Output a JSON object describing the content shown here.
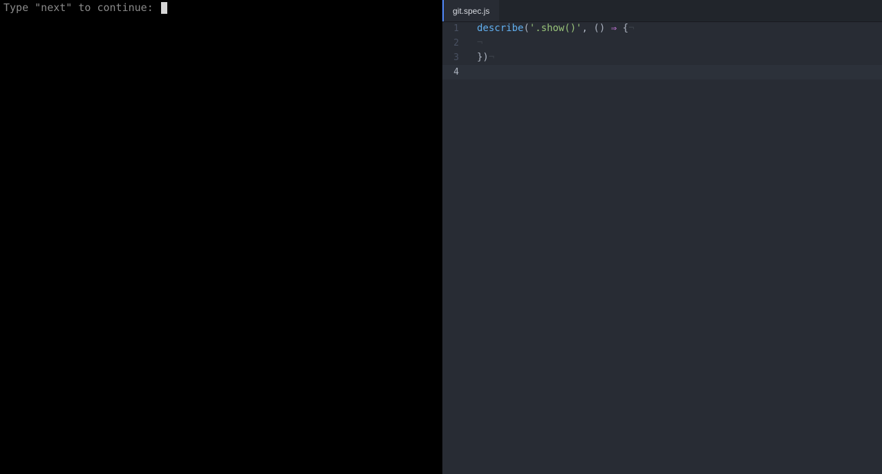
{
  "terminal": {
    "prompt": "Type \"next\" to continue: "
  },
  "editor": {
    "tab_title": "git.spec.js",
    "line_numbers": [
      "1",
      "2",
      "3",
      "4"
    ],
    "code": {
      "line1": {
        "fn": "describe",
        "open_paren": "(",
        "string": "'.show()'",
        "comma_parens": ", () ",
        "arrow": "⇒",
        "brace": " {",
        "eol": "¬"
      },
      "line2": {
        "eol": "¬"
      },
      "line3": {
        "text": "})",
        "eol": "¬"
      }
    }
  },
  "colors": {
    "editor_bg": "#282c34",
    "function": "#61afef",
    "string": "#98c379",
    "keyword": "#c678dd",
    "text": "#abb2bf",
    "tab_accent": "#528bff"
  }
}
